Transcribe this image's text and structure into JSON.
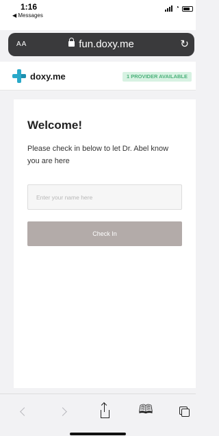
{
  "status_bar": {
    "time": "1:16",
    "back_app": "◀ Messages"
  },
  "browser": {
    "text_size_label": "AA",
    "url": "fun.doxy.me"
  },
  "site": {
    "logo_text": "doxy.me",
    "provider_badge": "1 PROVIDER AVAILABLE"
  },
  "checkin": {
    "title": "Welcome!",
    "message": "Please check in below to let Dr. Abel know you are here",
    "name_value": "",
    "name_placeholder": "Enter your name here",
    "button_label": "Check In"
  },
  "toolbar": {
    "items": [
      "back-icon",
      "forward-icon",
      "share-icon",
      "bookmarks-icon",
      "tabs-icon"
    ]
  },
  "colors": {
    "logo_accent": "#2aa9c9",
    "badge_bg": "#d7f2e2",
    "badge_text": "#4bb17a",
    "button_bg": "#b3aba9",
    "url_bar_bg": "#3a3a3c"
  }
}
